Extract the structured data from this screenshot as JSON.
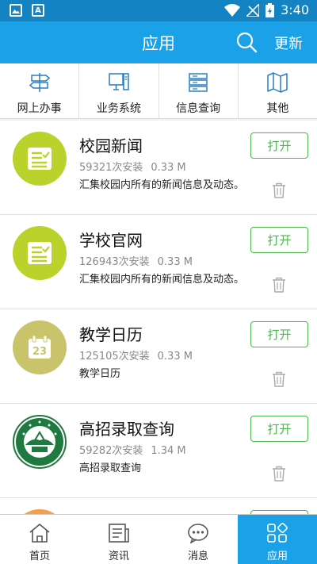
{
  "status_bar": {
    "time": "3:40"
  },
  "header": {
    "title": "应用",
    "update_label": "更新"
  },
  "categories": [
    {
      "label": "网上办事",
      "icon": "signpost-icon"
    },
    {
      "label": "业务系统",
      "icon": "computer-icon"
    },
    {
      "label": "信息查询",
      "icon": "server-icon"
    },
    {
      "label": "其他",
      "icon": "map-icon"
    }
  ],
  "apps": [
    {
      "name": "校园新闻",
      "installs": "59321次安装",
      "size": "0.33 M",
      "desc": "汇集校园内所有的新闻信息及动态。",
      "open_label": "打开",
      "logo_color": "#b9d22c",
      "icon": "news-doc-icon"
    },
    {
      "name": "学校官网",
      "installs": "126943次安装",
      "size": "0.33 M",
      "desc": "汇集校园内所有的新闻信息及动态。",
      "open_label": "打开",
      "logo_color": "#b9d22c",
      "icon": "news-doc-icon"
    },
    {
      "name": "教学日历",
      "installs": "125105次安装",
      "size": "0.33 M",
      "desc": "教学日历",
      "open_label": "打开",
      "logo_color": "#c9c46b",
      "icon": "calendar-icon"
    },
    {
      "name": "高招录取查询",
      "installs": "59282次安装",
      "size": "1.34 M",
      "desc": "高招录取查询",
      "open_label": "打开",
      "logo_color": "#1e7a3e",
      "icon": "university-seal-icon"
    }
  ],
  "tabs": [
    {
      "label": "首页",
      "icon": "home-icon",
      "active": false
    },
    {
      "label": "资讯",
      "icon": "news-icon",
      "active": false
    },
    {
      "label": "消息",
      "icon": "message-icon",
      "active": false
    },
    {
      "label": "应用",
      "icon": "apps-icon",
      "active": true
    }
  ],
  "colors": {
    "primary": "#1aa1e8",
    "status_bar": "#1483c4",
    "open_button": "#4cb84c"
  }
}
